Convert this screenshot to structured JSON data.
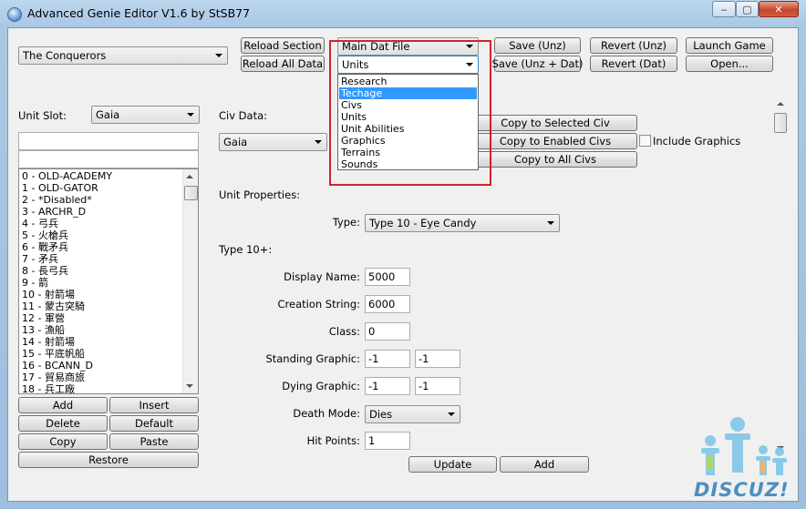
{
  "window": {
    "title": "Advanced Genie Editor V1.6 by StSB77",
    "controls": [
      "‒",
      "▢",
      "✕"
    ]
  },
  "top": {
    "game_combo": "The Conquerors",
    "reload_section": "Reload Section",
    "reload_all_data": "Reload All Data",
    "file_combo": "Main Dat File",
    "section_combo": "Units",
    "save_unz": "Save (Unz)",
    "save_unz_dat": "Save (Unz + Dat)",
    "revert_unz": "Revert (Unz)",
    "revert_dat": "Revert (Dat)",
    "launch_game": "Launch Game",
    "open": "Open..."
  },
  "dropdown": {
    "options": [
      "Research",
      "Techage",
      "Civs",
      "Units",
      "Unit Abilities",
      "Graphics",
      "Terrains",
      "Sounds"
    ],
    "selected": "Techage"
  },
  "left": {
    "unit_slot_label": "Unit Slot:",
    "unit_slot_value": "Gaia",
    "search_value": "",
    "filter_value": "",
    "units": [
      "0 - OLD-ACADEMY",
      "1 - OLD-GATOR",
      "2 - *Disabled*",
      "3 - ARCHR_D",
      "4 - 弓兵",
      "5 - 火槍兵",
      "6 - 戰矛兵",
      "7 - 矛兵",
      "8 - 長弓兵",
      "9 - 箭",
      "10 - 射箭場",
      "11 - 蒙古突騎",
      "12 - 軍營",
      "13 - 漁船",
      "14 - 射箭場",
      "15 - 平底帆船",
      "16 - BCANN_D",
      "17 - 貿易商旅",
      "18 - 兵工廠"
    ],
    "add": "Add",
    "insert": "Insert",
    "delete": "Delete",
    "default": "Default",
    "copy": "Copy",
    "paste": "Paste",
    "restore": "Restore"
  },
  "civ": {
    "label": "Civ Data:",
    "value": "Gaia",
    "copy_selected": "Copy to Selected Civ",
    "copy_enabled": "Copy to Enabled Civs",
    "copy_all": "Copy to All Civs",
    "include_graphics": "Include Graphics"
  },
  "props": {
    "section_label": "Unit Properties:",
    "type_label": "Type:",
    "type_value": "Type 10 - Eye Candy",
    "type10_label": "Type 10+:",
    "display_name_label": "Display Name:",
    "display_name": "5000",
    "creation_string_label": "Creation String:",
    "creation_string": "6000",
    "class_label": "Class:",
    "class": "0",
    "standing_graphic_label": "Standing Graphic:",
    "standing_graphic_1": "-1",
    "standing_graphic_2": "-1",
    "dying_graphic_label": "Dying Graphic:",
    "dying_graphic_1": "-1",
    "dying_graphic_2": "-1",
    "death_mode_label": "Death Mode:",
    "death_mode": "Dies",
    "hit_points_label": "Hit Points:",
    "hit_points": "1",
    "update": "Update",
    "add": "Add"
  },
  "watermark": {
    "text": "DISCUZ!"
  }
}
